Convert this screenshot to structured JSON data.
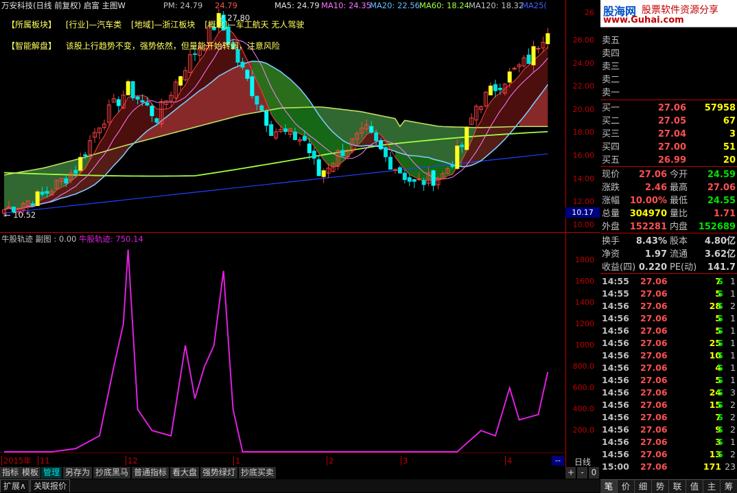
{
  "header": {
    "title": "万安科技(日线 前复权) 启富 主图W",
    "pm_label": "PM: 24.79",
    "close_label": "24.79",
    "peak_label": "27.80",
    "ma5": "MA5: 24.79",
    "ma10": "MA10: 24.35",
    "ma20": "MA20: 22.56",
    "ma60": "MA60: 18.24",
    "ma120": "MA120: 18.32",
    "ma250": "MA25("
  },
  "info": {
    "sector_label": "【所属板块】",
    "industry": "[行业]—汽车类",
    "region": "[地域]—浙江板块",
    "concept": "[概念]—军工航天 无人驾驶",
    "analysis_label": "【智能解盘】",
    "analysis_text": "该股上行趋势不变，强势依然，但量能开始转弱，注意风险"
  },
  "main_chart": {
    "low_label": "10.52",
    "price_axis": [
      "26.00",
      "24.00",
      "22.00",
      "20.00",
      "18.00",
      "16.00",
      "14.00",
      "12.00",
      "10.00"
    ],
    "price_top_cut": "26",
    "current_price_tag": "10.17"
  },
  "sub_chart": {
    "title": "牛股轨迹 副图 : 0.00",
    "series_label": "牛股轨迹: 750.14",
    "axis": [
      "1800",
      "1600",
      "1400",
      "1200",
      "1000",
      "800.0",
      "600.0",
      "400.0",
      "200.0"
    ]
  },
  "time_axis": {
    "labels": [
      "2015年",
      "11",
      "12",
      "1",
      "2",
      "3",
      "4"
    ],
    "period": "日线"
  },
  "bottom_buttons": [
    "指标",
    "模板",
    "管理",
    "另存为",
    "抄底黑马",
    "普通指标",
    "看大盘",
    "强势绿灯",
    "抄底买卖"
  ],
  "bottom_tabs": [
    "扩展∧",
    "关联报价"
  ],
  "zoom_controls": {
    "plus": "+",
    "minus": "-",
    "zero": "0",
    "dash": "--"
  },
  "panel": {
    "logo_cn": "股海网",
    "logo_sub": "股票软件资源分享",
    "logo_url": "www.Guhai.com",
    "sell_orders": [
      {
        "label": "卖五",
        "price": "",
        "vol": ""
      },
      {
        "label": "卖四",
        "price": "",
        "vol": ""
      },
      {
        "label": "卖三",
        "price": "",
        "vol": ""
      },
      {
        "label": "卖二",
        "price": "",
        "vol": ""
      },
      {
        "label": "卖一",
        "price": "",
        "vol": ""
      }
    ],
    "buy_orders": [
      {
        "label": "买一",
        "price": "27.06",
        "vol": "57958"
      },
      {
        "label": "买二",
        "price": "27.05",
        "vol": "67"
      },
      {
        "label": "买三",
        "price": "27.04",
        "vol": "3"
      },
      {
        "label": "买四",
        "price": "27.00",
        "vol": "51"
      },
      {
        "label": "买五",
        "price": "26.99",
        "vol": "20"
      }
    ],
    "quote1": [
      {
        "k1": "现价",
        "v1": "27.06",
        "c1": "#ff5050",
        "k2": "今开",
        "v2": "24.59",
        "c2": "#00e000"
      },
      {
        "k1": "涨跌",
        "v1": "2.46",
        "c1": "#ff5050",
        "k2": "最高",
        "v2": "27.06",
        "c2": "#ff5050"
      },
      {
        "k1": "涨幅",
        "v1": "10.00%",
        "c1": "#ff5050",
        "k2": "最低",
        "v2": "24.55",
        "c2": "#00e000"
      },
      {
        "k1": "总量",
        "v1": "304970",
        "c1": "#ffff00",
        "k2": "量比",
        "v2": "1.71",
        "c2": "#ff5050"
      },
      {
        "k1": "外盘",
        "v1": "152281",
        "c1": "#ff5050",
        "k2": "内盘",
        "v2": "152689",
        "c2": "#00e000"
      }
    ],
    "quote2": [
      {
        "k1": "换手",
        "v1": "8.43%",
        "c1": "#d0d0d0",
        "k2": "股本",
        "v2": "4.80亿",
        "c2": "#d0d0d0"
      },
      {
        "k1": "净资",
        "v1": "1.97",
        "c1": "#d0d0d0",
        "k2": "流通",
        "v2": "3.62亿",
        "c2": "#d0d0d0"
      },
      {
        "k1": "收益(四)",
        "v1": "0.220",
        "c1": "#d0d0d0",
        "k2": "PE(动)",
        "v2": "141.7",
        "c2": "#d0d0d0"
      }
    ],
    "ticks": [
      {
        "t": "14:55",
        "p": "27.06",
        "v": "7",
        "s": "S",
        "n": "1"
      },
      {
        "t": "14:55",
        "p": "27.06",
        "v": "5",
        "s": "S",
        "n": "1"
      },
      {
        "t": "14:56",
        "p": "27.06",
        "v": "28",
        "s": "S",
        "n": "2"
      },
      {
        "t": "14:56",
        "p": "27.06",
        "v": "5",
        "s": "S",
        "n": "1"
      },
      {
        "t": "14:56",
        "p": "27.06",
        "v": "5",
        "s": "S",
        "n": "1"
      },
      {
        "t": "14:56",
        "p": "27.06",
        "v": "25",
        "s": "S",
        "n": "1"
      },
      {
        "t": "14:56",
        "p": "27.06",
        "v": "10",
        "s": "S",
        "n": "1"
      },
      {
        "t": "14:56",
        "p": "27.06",
        "v": "4",
        "s": "S",
        "n": "1"
      },
      {
        "t": "14:56",
        "p": "27.06",
        "v": "5",
        "s": "S",
        "n": "1"
      },
      {
        "t": "14:56",
        "p": "27.06",
        "v": "24",
        "s": "S",
        "n": "3"
      },
      {
        "t": "14:56",
        "p": "27.06",
        "v": "15",
        "s": "S",
        "n": "2"
      },
      {
        "t": "14:56",
        "p": "27.06",
        "v": "7",
        "s": "S",
        "n": "2"
      },
      {
        "t": "14:56",
        "p": "27.06",
        "v": "9",
        "s": "S",
        "n": "2"
      },
      {
        "t": "14:56",
        "p": "27.06",
        "v": "3",
        "s": "S",
        "n": "1"
      },
      {
        "t": "14:56",
        "p": "27.06",
        "v": "13",
        "s": "S",
        "n": "2"
      },
      {
        "t": "15:00",
        "p": "27.06",
        "v": "171",
        "s": "",
        "n": "23"
      }
    ],
    "tabs": [
      "笔",
      "价",
      "细",
      "势",
      "联",
      "值",
      "主",
      "筹"
    ]
  },
  "colors": {
    "up": "#ff5050",
    "down": "#00e0e0",
    "curve": "#e020e0",
    "grid_red": "#c00000"
  }
}
